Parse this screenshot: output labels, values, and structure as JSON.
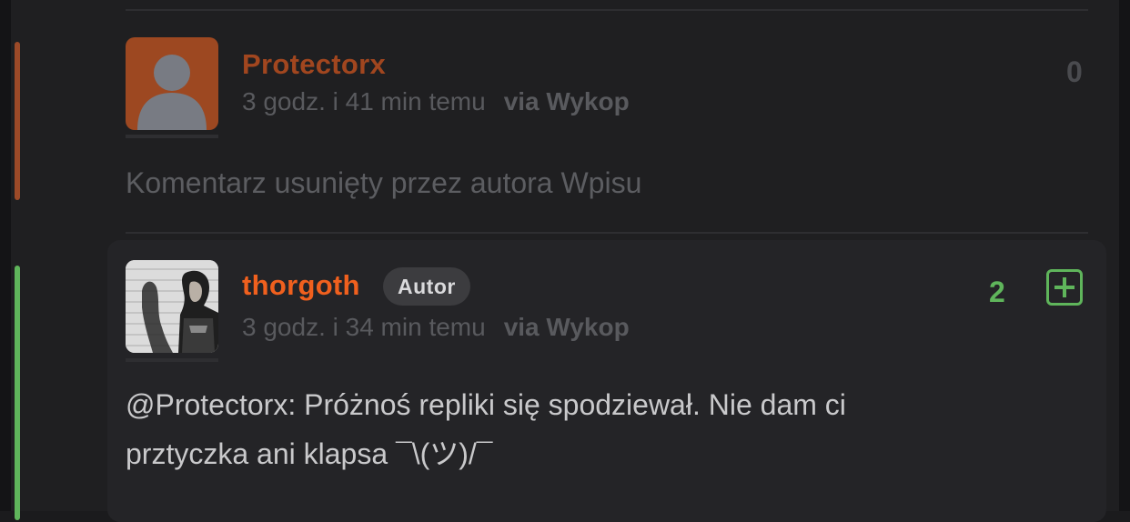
{
  "comments": [
    {
      "username": "Protectorx",
      "username_color": "#a1461f",
      "time": "3 godz. i 41 min temu",
      "via": "via Wykop",
      "votes": "0",
      "text": "Komentarz usunięty przez autora Wpisu",
      "accent_color": "#9c4a28",
      "avatar": "default-user-avatar-icon"
    },
    {
      "username": "thorgoth",
      "username_color": "#f0601e",
      "badge": "Autor",
      "time": "3 godz. i 34 min temu",
      "via": "via Wykop",
      "votes": "2",
      "votes_color": "#5fb55b",
      "text_line1": "@Protectorx: Próżnoś repliki się spodziewał. Nie dam ci",
      "text_line2": "prztyczka ani klapsa ¯\\(ツ)/¯",
      "accent_color": "#5fb55b",
      "avatar": "photo-avatar",
      "plus_icon": "plus-square-icon"
    }
  ]
}
